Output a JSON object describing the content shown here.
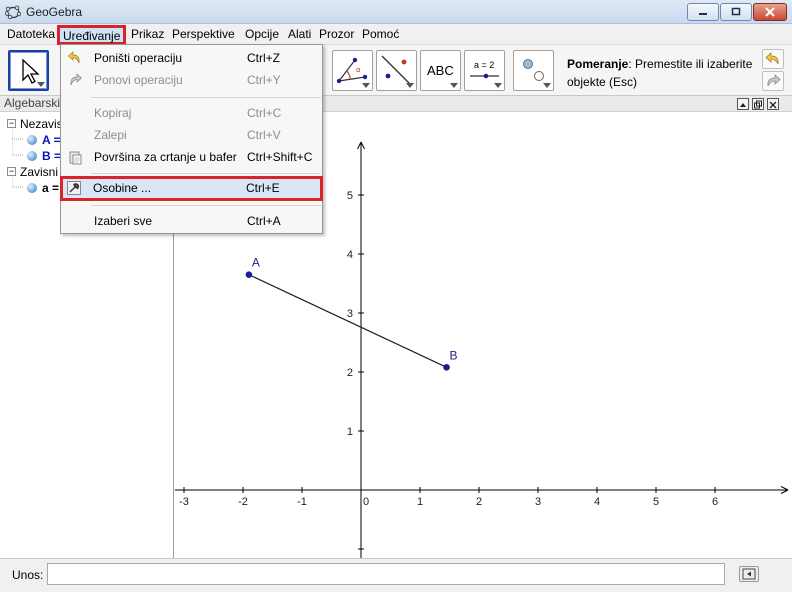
{
  "window": {
    "title": "GeoGebra"
  },
  "menubar": {
    "items": [
      "Datoteka",
      "Uređivanje",
      "Prikaz",
      "Perspektive",
      "Opcije",
      "Alati",
      "Prozor",
      "Pomoć"
    ],
    "active": "Uređivanje"
  },
  "toolbar": {
    "help_title": "Pomeranje",
    "help_text": ": Premestite ili izaberite objekte (Esc)",
    "text_tool_label": "ABC",
    "slider_tool_label": "a = 2"
  },
  "edit_menu": {
    "items": [
      {
        "label": "Poništi operaciju",
        "shortcut": "Ctrl+Z",
        "enabled": true,
        "icon": "undo-icon"
      },
      {
        "label": "Ponovi operaciju",
        "shortcut": "Ctrl+Y",
        "enabled": false,
        "icon": "redo-icon"
      },
      {
        "label": "Kopiraj",
        "shortcut": "Ctrl+C",
        "enabled": false,
        "icon": ""
      },
      {
        "label": "Zalepi",
        "shortcut": "Ctrl+V",
        "enabled": false,
        "icon": ""
      },
      {
        "label": "Površina za crtanje u bafer",
        "shortcut": "Ctrl+Shift+C",
        "enabled": true,
        "icon": "clipboard-icon"
      },
      {
        "label": "Osobine ...",
        "shortcut": "Ctrl+E",
        "enabled": true,
        "icon": "properties-icon",
        "highlighted": true
      },
      {
        "label": "Izaberi sve",
        "shortcut": "Ctrl+A",
        "enabled": true,
        "icon": ""
      }
    ]
  },
  "algebra_view": {
    "header": "Algebarski",
    "independent_label": "Nezavis",
    "dependent_label": "Zavisni",
    "objects": [
      {
        "name": "A =",
        "group": "independent"
      },
      {
        "name": "B =",
        "group": "independent"
      },
      {
        "name": "a =",
        "group": "dependent"
      }
    ]
  },
  "graphics_view": {
    "x_ticks": [
      "-3",
      "-2",
      "-1",
      "0",
      "1",
      "2",
      "3",
      "4",
      "5",
      "6"
    ],
    "y_ticks": [
      "1",
      "2",
      "3",
      "4",
      "5"
    ],
    "points": [
      {
        "label": "A",
        "x": -1.9,
        "y": 3.65
      },
      {
        "label": "B",
        "x": 1.45,
        "y": 2.08
      }
    ],
    "segment": {
      "from": "A",
      "to": "B"
    },
    "point_color": "#1d1d96"
  },
  "input_bar": {
    "label": "Unos:",
    "value": ""
  }
}
